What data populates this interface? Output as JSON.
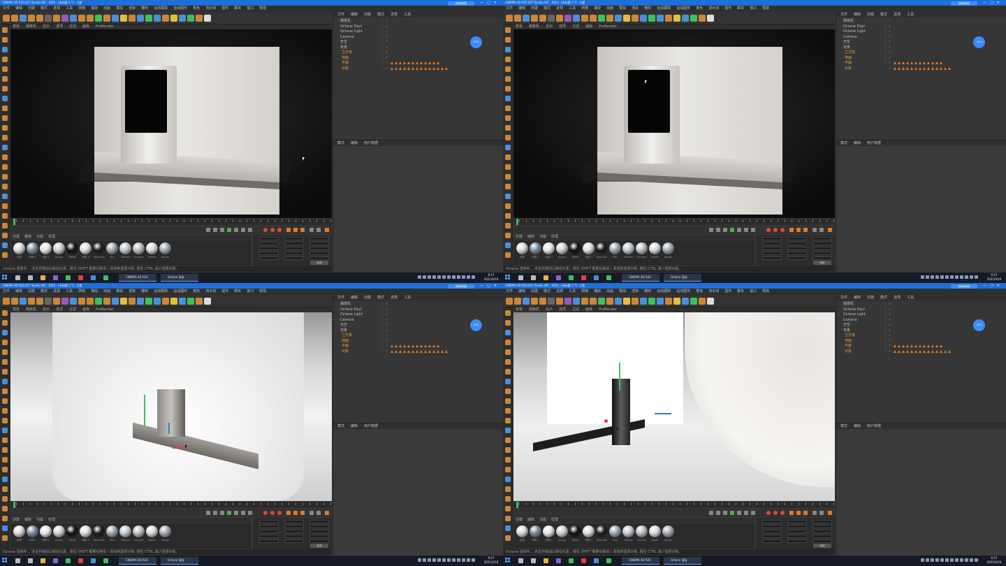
{
  "quadrants": [
    {
      "title": "CINEMA 4D R20.057 Studio (RC - R20) - [未标题 1 *] - 主要",
      "layout_label": "启动布局",
      "menu": [
        "文件",
        "编辑",
        "创建",
        "模式",
        "选择",
        "工具",
        "网格",
        "捕捉",
        "动画",
        "模拟",
        "渲染",
        "雕刻",
        "运动跟踪",
        "运动图形",
        "角色",
        "流水线",
        "插件",
        "脚本",
        "窗口",
        "帮助"
      ],
      "viewport_menu": [
        "查看",
        "摄像机",
        "显示",
        "选项",
        "过滤",
        "面板",
        "ProRender"
      ],
      "objects": [
        "摄像机",
        "Octane Dayl",
        "Octane Light",
        "Camera",
        "天空",
        "背景",
        "立方体",
        "地面",
        "平面",
        "对象"
      ],
      "attr_menu": [
        "模式",
        "编辑",
        "用户数据"
      ],
      "status": "Octane 渲染中...  点击并拖动以移动元素。按住 SHIFT 键量化移动 / 添加到选择对象; 按住 CTRL 减少选择对象。",
      "materials": [
        "材质",
        "材质.1",
        "材质.2",
        "Glossy",
        "Metal",
        "材质.3",
        "Specular",
        "Mix",
        "Diffuse",
        "Chrome",
        "Plastic",
        "Rough"
      ],
      "mat_menu": [
        "创建",
        "编辑",
        "功能",
        "纹理"
      ],
      "coord_apply": "应用",
      "badge": "42%"
    }
  ],
  "taskbar": {
    "apps": [
      "CINEMA 4D R20",
      "Octane 渲染"
    ],
    "time": "6:57",
    "date": "2021/4/16"
  },
  "colors": {
    "accent": "#3d8cff",
    "tag_orange": "#e07a2b",
    "titlebar": "#1e6fd9"
  }
}
